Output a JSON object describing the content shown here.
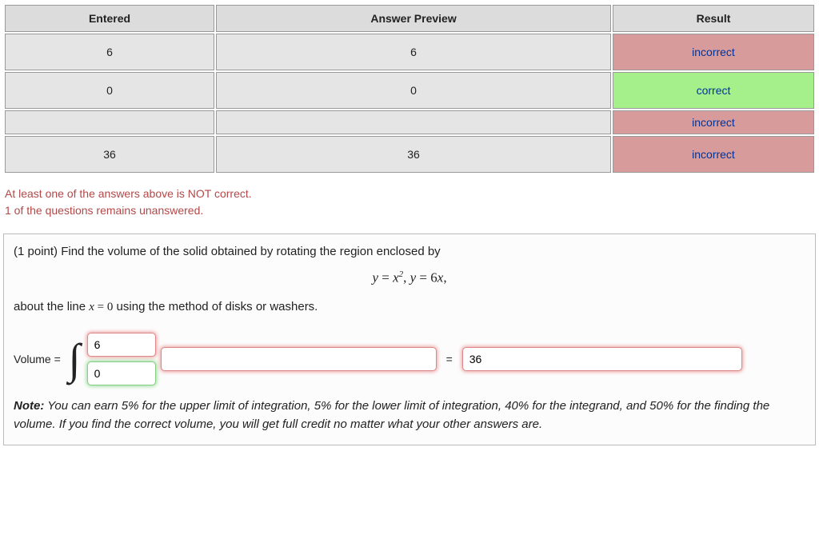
{
  "table": {
    "headers": {
      "entered": "Entered",
      "preview": "Answer Preview",
      "result": "Result"
    },
    "rows": [
      {
        "entered": "6",
        "preview": "6",
        "result": "incorrect",
        "status": "incorrect"
      },
      {
        "entered": "0",
        "preview": "0",
        "result": "correct",
        "status": "correct"
      },
      {
        "entered": "",
        "preview": "",
        "result": "incorrect",
        "status": "incorrect",
        "thin": true
      },
      {
        "entered": "36",
        "preview": "36",
        "result": "incorrect",
        "status": "incorrect"
      }
    ]
  },
  "messages": {
    "line1": "At least one of the answers above is NOT correct.",
    "line2": "1 of the questions remains unanswered."
  },
  "problem": {
    "intro": "(1 point) Find the volume of the solid obtained by rotating the region enclosed by",
    "eq_y1a": "y",
    "eq_eq1": " = ",
    "eq_x": "x",
    "eq_sq": "2",
    "eq_comma": ",  ",
    "eq_y2a": "y",
    "eq_eq2": " = 6",
    "eq_x2": "x",
    "eq_end": ",",
    "about_a": "about the line ",
    "about_var": "x",
    "about_eqz": " = 0",
    "about_b": " using the method of disks or washers.",
    "volume_label": "Volume =",
    "equals": "=",
    "inputs": {
      "upper": "6",
      "lower": "0",
      "integrand": "",
      "answer": "36"
    },
    "note_bold": "Note:",
    "note_text": " You can earn 5% for the upper limit of integration, 5% for the lower limit of integration, 40% for the integrand, and 50% for the finding the volume. If you find the correct volume, you will get full credit no matter what your other answers are."
  }
}
